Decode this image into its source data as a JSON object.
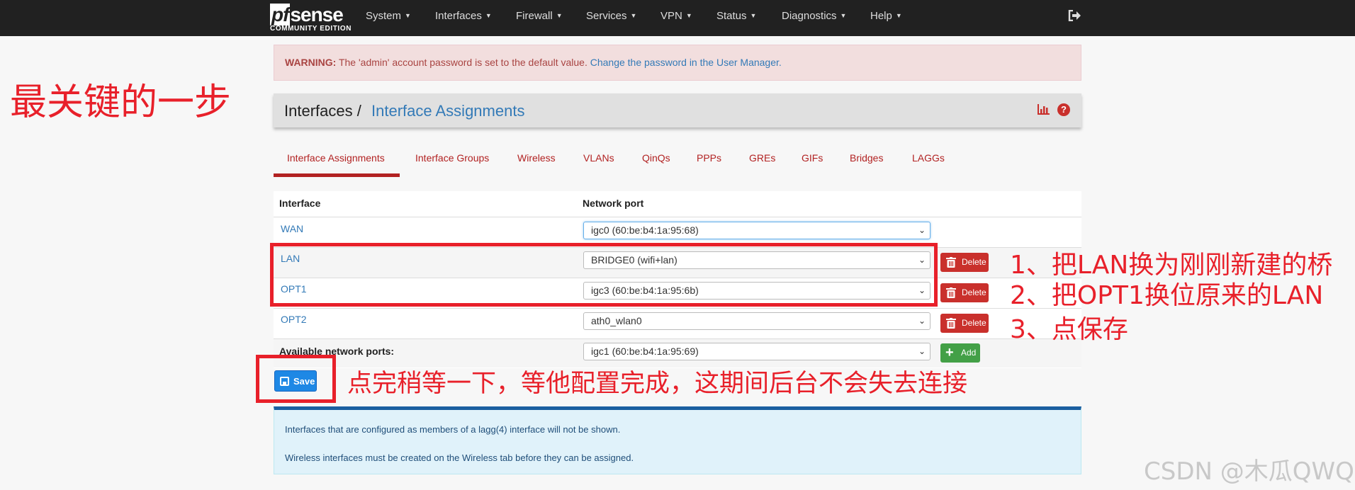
{
  "navbar": {
    "brand_logo_pf": "pf",
    "brand_logo_sense": "sense",
    "brand_edition": "COMMUNITY EDITION",
    "menu": [
      "System",
      "Interfaces",
      "Firewall",
      "Services",
      "VPN",
      "Status",
      "Diagnostics",
      "Help"
    ],
    "logout_icon": "sign-out-icon"
  },
  "warning": {
    "label": "WARNING:",
    "text": "The 'admin' account password is set to the default value.",
    "link": "Change the password in the User Manager."
  },
  "breadcrumb": {
    "parent": "Interfaces /",
    "current": "Interface Assignments"
  },
  "tabs": [
    "Interface Assignments",
    "Interface Groups",
    "Wireless",
    "VLANs",
    "QinQs",
    "PPPs",
    "GREs",
    "GIFs",
    "Bridges",
    "LAGGs"
  ],
  "active_tab": "Interface Assignments",
  "table": {
    "headers": {
      "interface": "Interface",
      "network_port": "Network port"
    },
    "rows": [
      {
        "name": "WAN",
        "port": "igc0 (60:be:b4:1a:95:68)",
        "deletable": false
      },
      {
        "name": "LAN",
        "port": "BRIDGE0 (wifi+lan)",
        "deletable": true
      },
      {
        "name": "OPT1",
        "port": "igc3 (60:be:b4:1a:95:6b)",
        "deletable": true
      },
      {
        "name": "OPT2",
        "port": "ath0_wlan0",
        "deletable": true
      }
    ],
    "available_label": "Available network ports:",
    "available_port": "igc1 (60:be:b4:1a:95:69)",
    "delete_label": "Delete",
    "add_label": "Add"
  },
  "save_label": "Save",
  "info": {
    "line1": "Interfaces that are configured as members of a lagg(4) interface will not be shown.",
    "line2": "Wireless interfaces must be created on the Wireless tab before they can be assigned."
  },
  "annotations": {
    "title": "最关键的一步",
    "step1": "1、把LAN换为刚刚新建的桥",
    "step2": "2、把OPT1换位原来的LAN",
    "step3": "3、点保存",
    "save_note": "点完稍等一下，等他配置完成，这期间后台不会失去连接"
  },
  "watermark": "CSDN @木瓜QWQ",
  "colors": {
    "navbar": "#212121",
    "link": "#337ab7",
    "tab": "#b22222",
    "delete": "#c9302c",
    "add": "#43a047",
    "save": "#1e88e5",
    "annotation": "#e8202a"
  }
}
